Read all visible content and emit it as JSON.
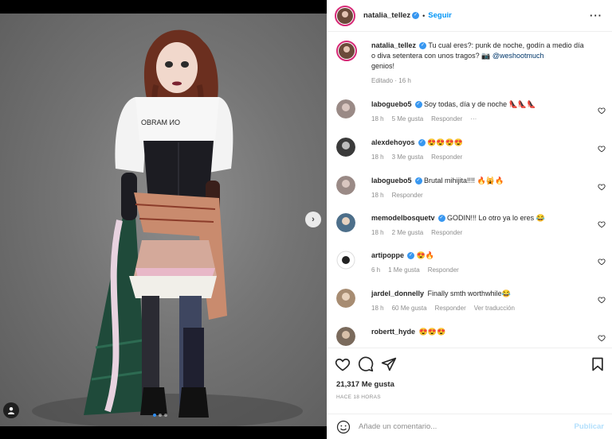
{
  "post": {
    "author": "natalia_tellez",
    "follow_label": "Seguir",
    "caption_user": "natalia_tellez",
    "caption_text": "Tu cual eres?: punk de noche, godín a medio día o diva setentera con unos tragos? 📷",
    "caption_mention": "@weshootmuch",
    "caption_tail": "genios!",
    "caption_meta": "Editado · 16 h",
    "shirt_text": "OBRAM ИO",
    "carousel": {
      "slides": 3,
      "active": 0
    }
  },
  "comments": [
    {
      "user": "laboguebo5",
      "verified": true,
      "text": "Soy todas, día y de noche",
      "emoji": "👠👠👠",
      "time": "18 h",
      "likes": "5 Me gusta",
      "reply": "Responder",
      "extra": "···"
    },
    {
      "user": "alexdehoyos",
      "verified": true,
      "text": "",
      "emoji": "😍😍😍😍",
      "time": "18 h",
      "likes": "3 Me gusta",
      "reply": "Responder",
      "extra": ""
    },
    {
      "user": "laboguebo5",
      "verified": true,
      "text": "Brutal mihijita!!!!",
      "emoji": "🔥🙀🔥",
      "time": "18 h",
      "likes": "",
      "reply": "Responder",
      "extra": ""
    },
    {
      "user": "memodelbosquetv",
      "verified": true,
      "text": "GODIN!!! Lo otro ya lo eres",
      "emoji": "😂",
      "time": "18 h",
      "likes": "2 Me gusta",
      "reply": "Responder",
      "extra": ""
    },
    {
      "user": "artipoppe",
      "verified": true,
      "text": "",
      "emoji": "😍🔥",
      "time": "6 h",
      "likes": "1 Me gusta",
      "reply": "Responder",
      "extra": ""
    },
    {
      "user": "jardel_donnelly",
      "verified": false,
      "text": "Finally smth worthwhile",
      "emoji": "😂",
      "time": "18 h",
      "likes": "60 Me gusta",
      "reply": "Responder",
      "extra": "Ver traducción"
    },
    {
      "user": "robertt_hyde",
      "verified": false,
      "text": "",
      "emoji": "😍😍😍",
      "time": "",
      "likes": "",
      "reply": "",
      "extra": ""
    }
  ],
  "footer": {
    "likes": "21,317 Me gusta",
    "time_ago": "HACE 18 HORAS",
    "comment_placeholder": "Añade un comentario...",
    "publish_label": "Publicar"
  },
  "colors": {
    "accent": "#0095f6",
    "verified": "#3897f0",
    "muted": "#8e8e8e"
  }
}
